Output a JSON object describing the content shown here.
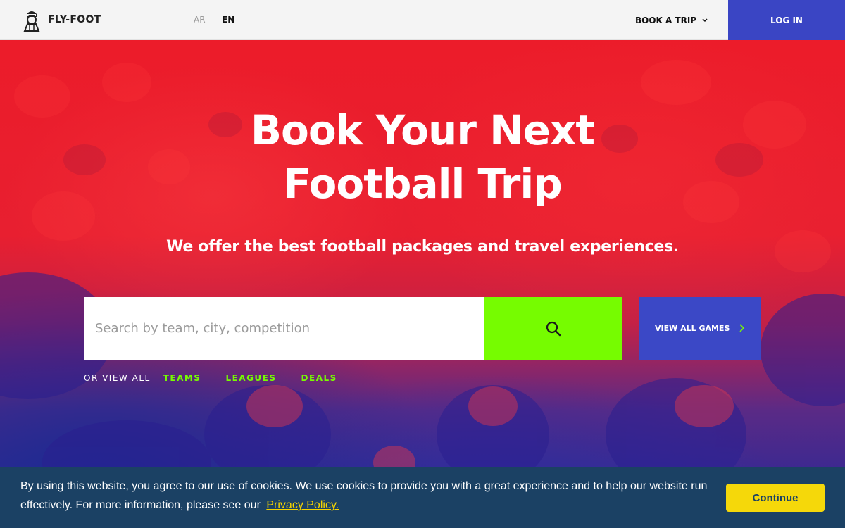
{
  "header": {
    "brand": "FLY-FOOT",
    "lang_ar": "AR",
    "lang_en": "EN",
    "book_trip": "BOOK A TRIP",
    "login": "LOG IN"
  },
  "hero": {
    "title_line1": "Book Your Next",
    "title_line2": "Football Trip",
    "subtitle": "We offer the best football packages and travel experiences.",
    "search_placeholder": "Search by team, city, competition",
    "view_all_games": "VIEW ALL GAMES",
    "links_prefix": "OR VIEW ALL",
    "links": [
      "TEAMS",
      "LEAGUES",
      "DEALS"
    ]
  },
  "cookie": {
    "text": "By using this website, you agree to our use of cookies. We use cookies to provide you with a great experience and to help our website run effectively. For more information, please see our",
    "policy_link": "Privacy Policy.",
    "continue": "Continue"
  },
  "colors": {
    "accent_green": "#76fc00",
    "accent_blue": "#3b48c6",
    "hero_red": "#ec1c2a",
    "cookie_bg": "#1b4164",
    "cookie_button": "#f5d80a"
  },
  "icons": {
    "logo": "mascot-logo-icon",
    "search": "search-icon",
    "dropdown": "chevron-down-icon",
    "view_all_arrow": "chevron-right-icon"
  }
}
